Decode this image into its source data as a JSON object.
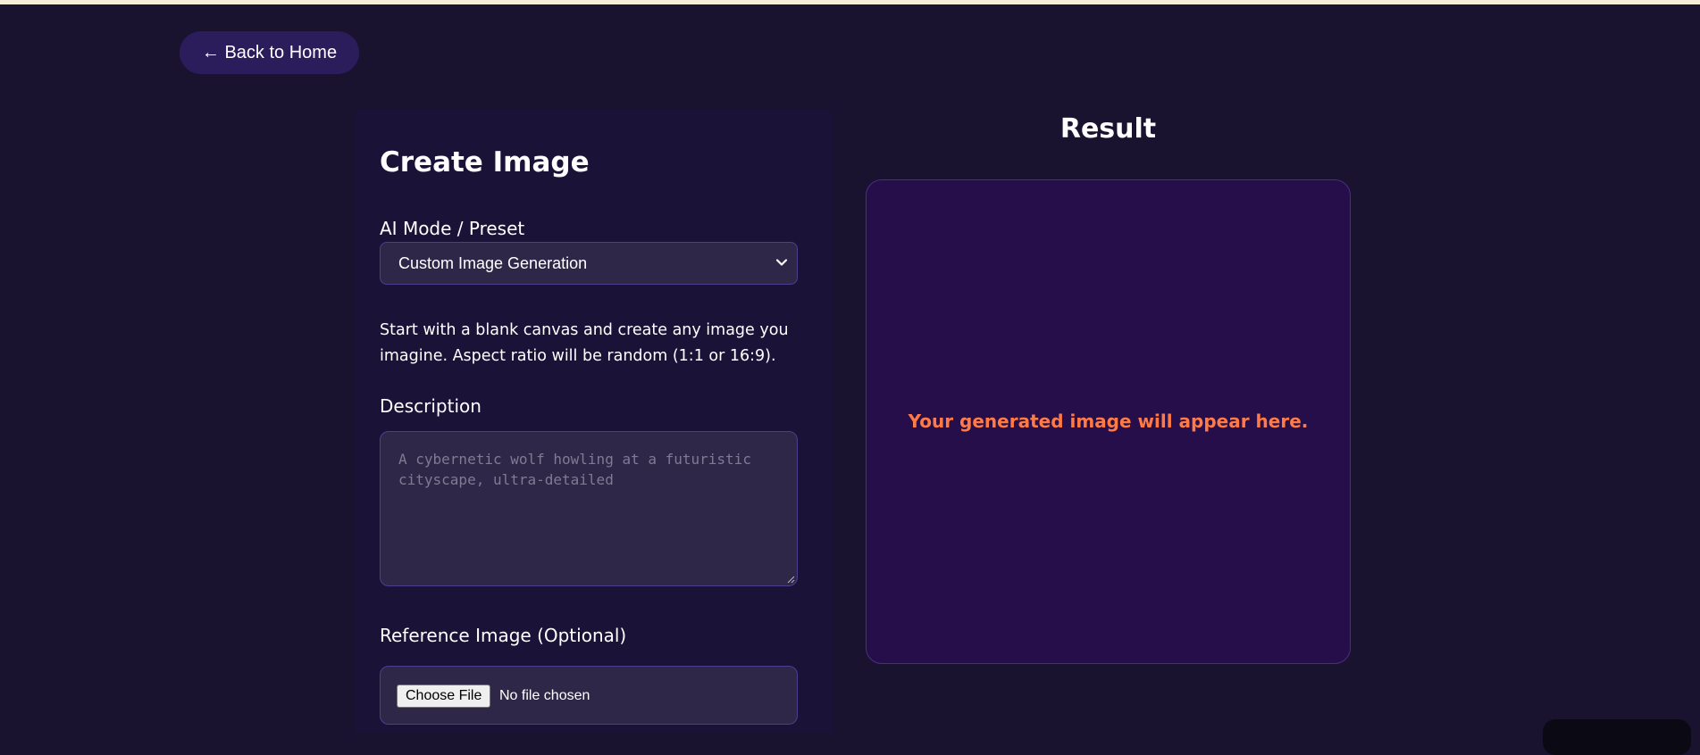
{
  "nav": {
    "back_label": "← Back to Home"
  },
  "form": {
    "title": "Create Image",
    "mode_label": "AI Mode / Preset",
    "mode_selected": "Custom Image Generation",
    "mode_description": "Start with a blank canvas and create any image you imagine. Aspect ratio will be random (1:1 or 16:9).",
    "description_label": "Description",
    "description_placeholder": "A cybernetic wolf howling at a futuristic cityscape, ultra-detailed",
    "reference_label": "Reference Image (Optional)",
    "choose_file_label": "Choose File",
    "file_status": "No file chosen"
  },
  "result": {
    "title": "Result",
    "placeholder": "Your generated image will appear here."
  },
  "colors": {
    "background": "#1a1330",
    "panel": "#1b1238",
    "input": "#2e2748",
    "result_box": "#260e4a",
    "accent": "#ff7a45",
    "back_button": "#2b1d5c"
  },
  "icons": {
    "select_chevron": "chevron-down-icon",
    "textarea_resize": "resize-grip-icon"
  }
}
